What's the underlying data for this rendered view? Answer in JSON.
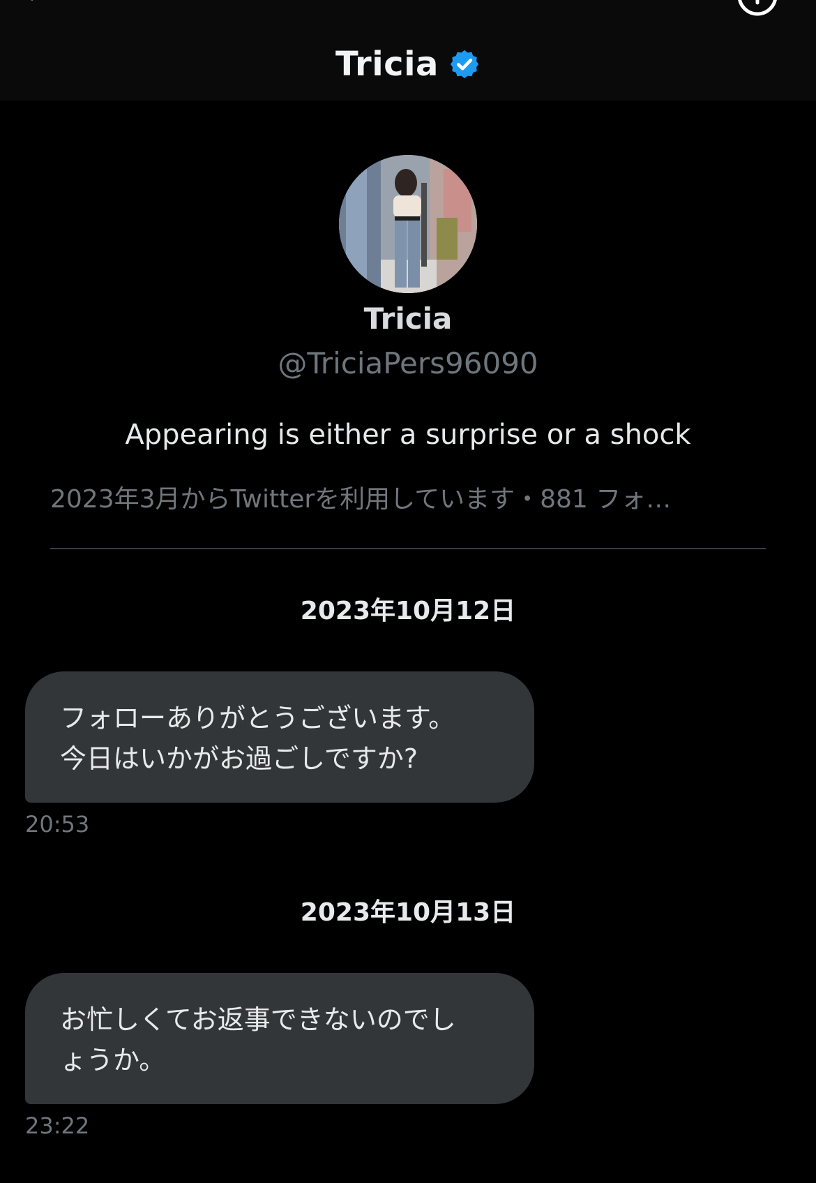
{
  "header": {
    "title": "Tricia",
    "back_icon": "chevron-left-icon",
    "info_icon": "info-icon",
    "verified_icon": "verified-badge-icon",
    "verified_color": "#1d9bf0"
  },
  "profile": {
    "name": "Tricia",
    "handle": "@TriciaPers96090",
    "bio": "Appearing is either a surprise or a shock",
    "meta": "2023年3月からTwitterを利用しています・881 フォ…"
  },
  "conversation": [
    {
      "date": "2023年10月12日",
      "text": "フォローありがとうございます。\n今日はいかがお過ごしですか?",
      "time": "20:53"
    },
    {
      "date": "2023年10月13日",
      "text": "お忙しくてお返事できないのでし\nょうか。",
      "time": "23:22"
    }
  ],
  "colors": {
    "background": "#000000",
    "header_bg": "#0a0a0b",
    "bubble_bg": "#333639",
    "muted_text": "#71767b"
  }
}
